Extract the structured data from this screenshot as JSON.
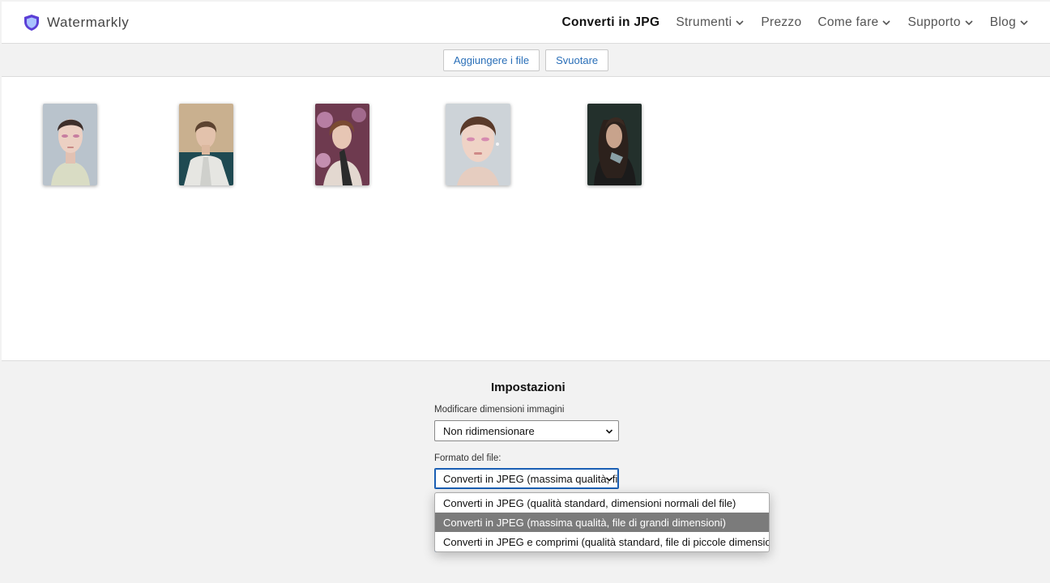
{
  "header": {
    "logo_text": "Watermarkly",
    "nav": [
      {
        "label": "Converti in JPG",
        "dropdown": false,
        "active": true
      },
      {
        "label": "Strumenti",
        "dropdown": true,
        "active": false
      },
      {
        "label": "Prezzo",
        "dropdown": false,
        "active": false
      },
      {
        "label": "Come fare",
        "dropdown": true,
        "active": false
      },
      {
        "label": "Supporto",
        "dropdown": true,
        "active": false
      },
      {
        "label": "Blog",
        "dropdown": true,
        "active": false
      }
    ]
  },
  "toolbar": {
    "add_files_label": "Aggiungere i file",
    "clear_label": "Svuotare"
  },
  "gallery": {
    "images": [
      {
        "subject": "woman-pink-eyeshadow-gray-background"
      },
      {
        "subject": "woman-white-jacket-beige-background"
      },
      {
        "subject": "person-scarf-purple-background"
      },
      {
        "subject": "woman-closeup-gray-background"
      },
      {
        "subject": "woman-dark-hair-dark-background"
      }
    ]
  },
  "settings": {
    "title": "Impostazioni",
    "resize_label": "Modificare dimensioni immagini",
    "resize_value": "Non ridimensionare",
    "format_label": "Formato del file:",
    "format_value": "Converti in JPEG (massima qualità, file di grandi dimensioni)",
    "format_options": [
      "Converti in JPEG (qualità standard, dimensioni normali del file)",
      "Converti in JPEG (massima qualità, file di grandi dimensioni)",
      "Converti in JPEG e comprimi (qualità standard, file di piccole dimensioni)"
    ],
    "selected_option_index": 1
  },
  "colors": {
    "accent": "#2a6fb8",
    "logo": "#5b3fd6",
    "selected_option_bg": "#7b7b7b"
  }
}
